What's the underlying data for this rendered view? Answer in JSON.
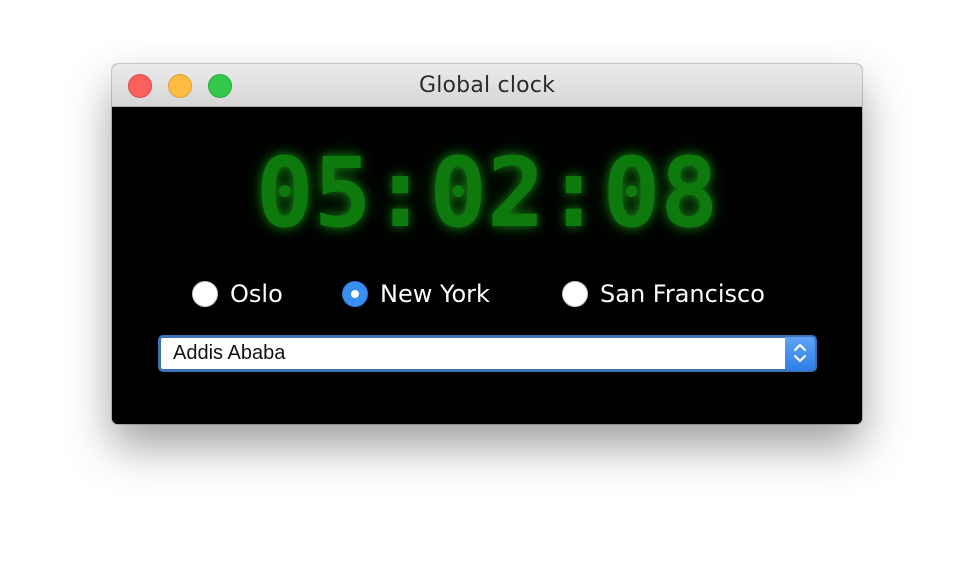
{
  "window": {
    "title": "Global clock"
  },
  "clock": {
    "time": "05:02:08",
    "color": "#0e7a0e"
  },
  "cities": {
    "options": [
      {
        "label": "Oslo",
        "selected": false
      },
      {
        "label": "New York",
        "selected": true
      },
      {
        "label": "San Francisco",
        "selected": false
      }
    ],
    "accent": "#3a8ef0"
  },
  "timezone_select": {
    "value": "Addis Ababa",
    "icon": "updown-chevron-icon"
  }
}
